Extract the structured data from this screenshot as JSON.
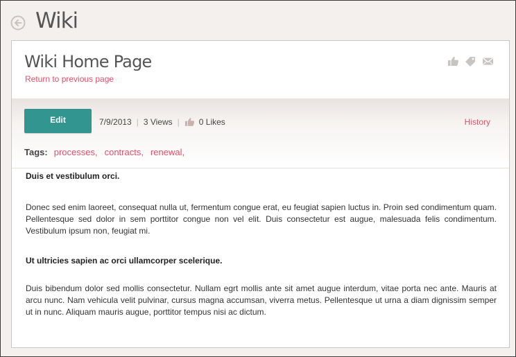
{
  "app": {
    "title": "Wiki",
    "back_icon": "back-arrow-circle-icon"
  },
  "page": {
    "title": "Wiki Home Page",
    "return_link": "Return to previous page",
    "header_icons": [
      "thumbs-up-icon",
      "tag-icon",
      "mail-icon"
    ]
  },
  "toolbar": {
    "edit_label": "Edit",
    "date": "7/9/2013",
    "views": "3 Views",
    "likes": "0 Likes",
    "history_label": "History"
  },
  "tags": {
    "label": "Tags:",
    "items": [
      "processes,",
      "contracts,",
      "renewal,"
    ]
  },
  "content": {
    "heading1": "Duis et vestibulum orci.",
    "paragraph1": "Donec sed enim laoreet, consequat nulla ut, fermentum congue erat, eu feugiat sapien luctus in. Proin sed condimentum quam. Pellentesque sed dolor in sem porttitor congue non vel elit. Duis consectetur est augue, malesuada felis condimentum. Vestibulum ipsum non, feugiat mi.",
    "heading2": "Ut ultricies sapien ac orci ullamcorper scelerique.",
    "paragraph2": "Duis bibendum dolor sed mollis consectetur. Nullam egrt mollis ante sit amet augue interdum, vitae porta nec ante. Mauris at arcu nunc. Nam vehicula velit pulvinar, cursus magna accumsan, viverra metus. Pellentesque ut urna a diam dignissim semper ut in nunc. Aliquam mauris augue, porttitor tempus nisi ac dictum."
  },
  "colors": {
    "accent_button": "#33958f",
    "link": "#e0506a",
    "background": "#f4f0ee"
  }
}
